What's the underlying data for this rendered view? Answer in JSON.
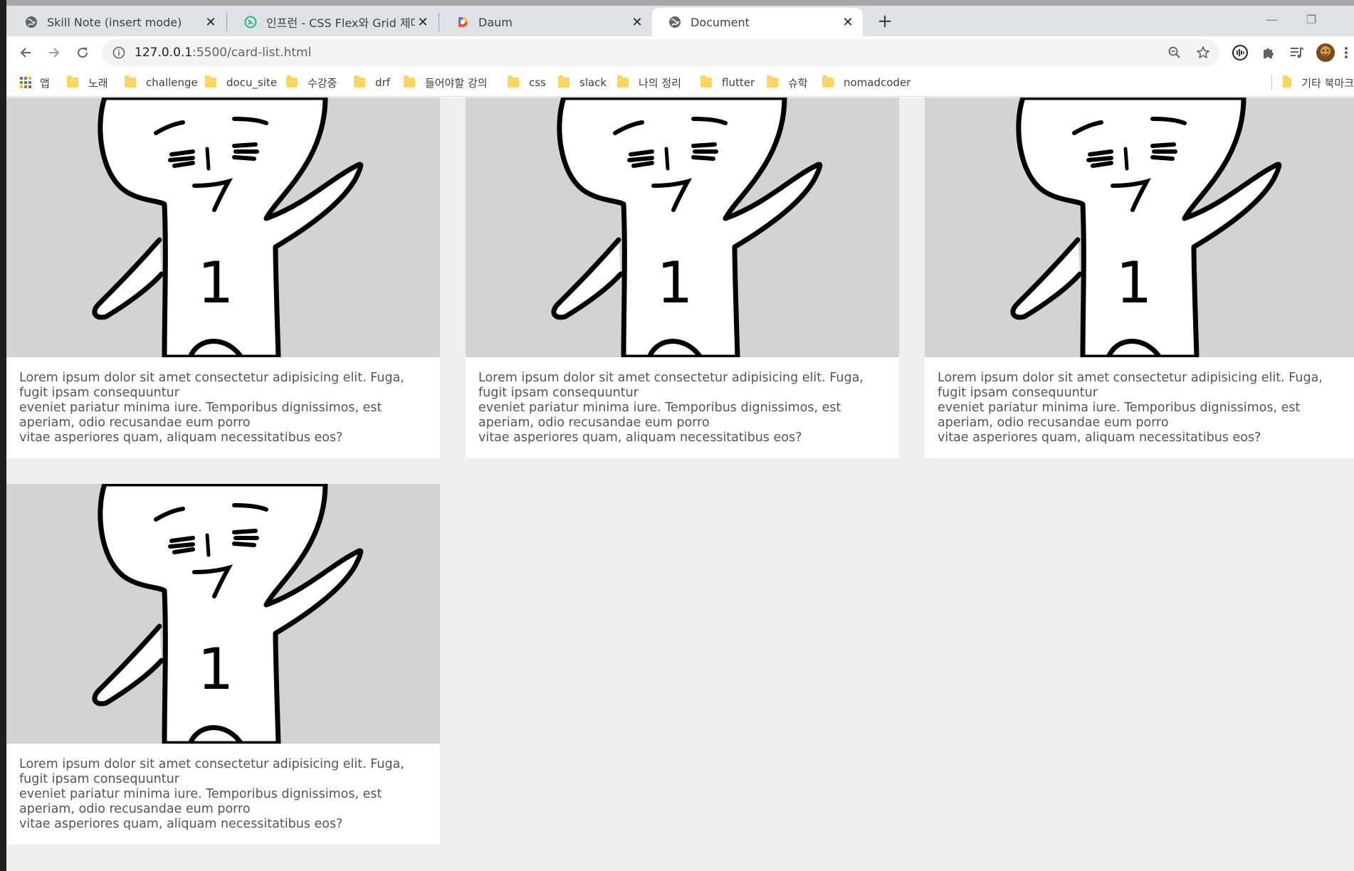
{
  "browser": {
    "tabs": [
      {
        "title": "Skill Note (insert mode)",
        "favicon": "globe-icon",
        "active": false
      },
      {
        "title": "인프런 - CSS Flex와 Grid 제대로 익히기",
        "favicon": "inflearn-icon",
        "active": false
      },
      {
        "title": "Daum",
        "favicon": "daum-icon",
        "active": false
      },
      {
        "title": "Document",
        "favicon": "globe-icon",
        "active": true
      }
    ],
    "new_tab": "+",
    "address": {
      "host": "127.0.0.1",
      "path": ":5500/card-list.html"
    },
    "bookmarks": [
      {
        "label": "앱",
        "icon": "apps-grid-icon"
      },
      {
        "label": "노래",
        "icon": "folder-icon"
      },
      {
        "label": "challenge",
        "icon": "folder-icon"
      },
      {
        "label": "docu_site",
        "icon": "folder-icon"
      },
      {
        "label": "수강중",
        "icon": "folder-icon"
      },
      {
        "label": "drf",
        "icon": "folder-icon"
      },
      {
        "label": "들어야할 강의",
        "icon": "folder-icon"
      },
      {
        "label": "css",
        "icon": "folder-icon"
      },
      {
        "label": "slack",
        "icon": "folder-icon"
      },
      {
        "label": "나의 정리",
        "icon": "folder-icon"
      },
      {
        "label": "flutter",
        "icon": "folder-icon"
      },
      {
        "label": "슈학",
        "icon": "folder-icon"
      },
      {
        "label": "nomadcoder",
        "icon": "folder-icon"
      }
    ],
    "other_bookmarks": "기타 북마크"
  },
  "cards": [
    {
      "text": "Lorem ipsum dolor sit amet consectetur adipisicing elit. Fuga, fugit ipsam consequuntur\neveniet pariatur minima iure. Temporibus dignissimos, est aperiam, odio recusandae eum porro\nvitae asperiores quam, aliquam necessitatibus eos?",
      "image_label": "1"
    },
    {
      "text": "Lorem ipsum dolor sit amet consectetur adipisicing elit. Fuga, fugit ipsam consequuntur\neveniet pariatur minima iure. Temporibus dignissimos, est aperiam, odio recusandae eum porro\nvitae asperiores quam, aliquam necessitatibus eos?",
      "image_label": "1"
    },
    {
      "text": "Lorem ipsum dolor sit amet consectetur adipisicing elit. Fuga, fugit ipsam consequuntur\neveniet pariatur minima iure. Temporibus dignissimos, est aperiam, odio recusandae eum porro\nvitae asperiores quam, aliquam necessitatibus eos?",
      "image_label": "1"
    },
    {
      "text": "Lorem ipsum dolor sit amet consectetur adipisicing elit. Fuga, fugit ipsam consequuntur\neveniet pariatur minima iure. Temporibus dignissimos, est aperiam, odio recusandae eum porro\nvitae asperiores quam, aliquam necessitatibus eos?",
      "image_label": "1"
    }
  ],
  "colors": {
    "page_bg": "#eeeeee",
    "card_bg": "#ffffff",
    "thumb_bg": "#d3d3d3",
    "text": "#555555"
  }
}
